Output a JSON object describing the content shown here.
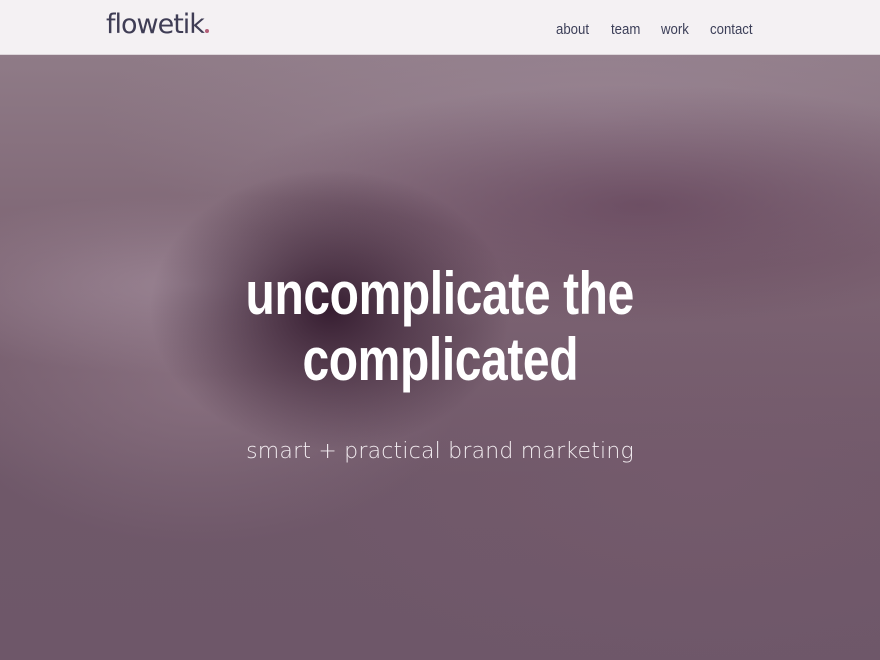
{
  "header": {
    "logo_text": "flowetik",
    "nav": [
      {
        "label": "about"
      },
      {
        "label": "team"
      },
      {
        "label": "work"
      },
      {
        "label": "contact"
      }
    ]
  },
  "hero": {
    "headline_line1": "uncomplicate the",
    "headline_line2": "complicated",
    "subline": "smart + practical brand marketing"
  },
  "colors": {
    "header_bg": "#f4f1f3",
    "nav_text": "#3c3f58",
    "logo_text": "#3f3d55",
    "logo_accent_dot": "#b25e77",
    "hero_tint": "#7a6270",
    "hero_text": "#ffffff"
  }
}
